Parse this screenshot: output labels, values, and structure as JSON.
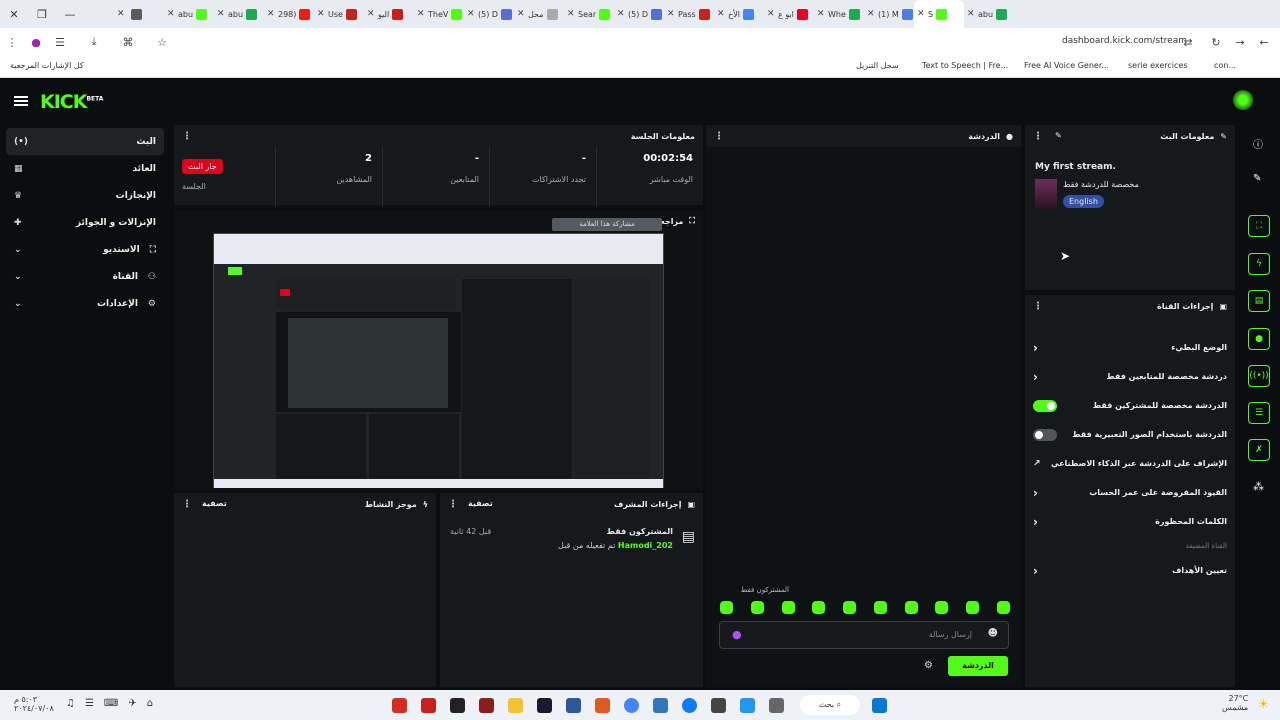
{
  "browser": {
    "tabs": [
      {
        "label": "",
        "color": "#5b5b5b"
      },
      {
        "label": "abu",
        "color": "#53fc18"
      },
      {
        "label": "abu",
        "color": "#1fa855"
      },
      {
        "label": "298)",
        "color": "#e62117"
      },
      {
        "label": "Use",
        "color": "#c5221f"
      },
      {
        "label": "اليو",
        "color": "#c5221f"
      },
      {
        "label": "TheV",
        "color": "#53fc18"
      },
      {
        "label": "(5) D",
        "color": "#5a6cd6"
      },
      {
        "label": "محل",
        "color": "#aaaaaa"
      },
      {
        "label": "Sear",
        "color": "#53fc18"
      },
      {
        "label": "(5) D",
        "color": "#5a6cd6"
      },
      {
        "label": "Pass",
        "color": "#c5221f"
      },
      {
        "label": "الأخ",
        "color": "#4285f4"
      },
      {
        "label": "ابو ع",
        "color": "#e60023"
      },
      {
        "label": "Whe",
        "color": "#1fa855"
      },
      {
        "label": "(1) M",
        "color": "#4c7de0"
      },
      {
        "label": "S",
        "color": "#53fc18",
        "active": true
      },
      {
        "label": "abu",
        "color": "#1fa855"
      }
    ],
    "url": "dashboard.kick.com/stream",
    "bookmarks": {
      "all": "كل الإشارات المرجعية",
      "history": "سجل التنزيل",
      "tts": "Text to Speech | Fre...",
      "voice": "Free AI Voice Gener...",
      "series": "serie exercices",
      "con": "con..."
    }
  },
  "app": {
    "logo": "KICK",
    "logo_beta": "BETA"
  },
  "sidebar": {
    "items": [
      {
        "label": "البث",
        "icon": "(•)"
      },
      {
        "label": "العائد",
        "icon": "▦"
      },
      {
        "label": "الإنجازات",
        "icon": "🏆"
      },
      {
        "label": "الإنزالات و الجوائز",
        "icon": "🎁"
      },
      {
        "label": "الاستديو",
        "icon": "⛶"
      },
      {
        "label": "القناة",
        "icon": "⚇"
      },
      {
        "label": "الإعدادات",
        "icon": "⚙"
      }
    ]
  },
  "session": {
    "title": "معلومات الجلسة",
    "stats": [
      {
        "value": "00:02:54",
        "label": "الوقت مباشر"
      },
      {
        "value": "-",
        "label": "تجدد الاشتراكات"
      },
      {
        "value": "-",
        "label": "المتابعين"
      },
      {
        "value": "2",
        "label": "المشاهدين"
      }
    ],
    "live_badge": "جار البث",
    "session_label": "الجلسة"
  },
  "preview": {
    "title": "مراجعة البث",
    "overlay_text": "مشاركة هذا العلامة"
  },
  "activity": {
    "title": "موجز النشاط",
    "filter": "تصفية"
  },
  "mod": {
    "title": "إجراءات المشرف",
    "filter": "تصفية",
    "entry_title": "المشتركون فقط",
    "entry_user": "Hamodi_202",
    "entry_desc": "تم تفعيله من قبل",
    "entry_time": "قبل 42 ثانية"
  },
  "chat": {
    "title": "الدردشة",
    "subs_only": "المشتركون فقط",
    "placeholder": "إرسال رسالة",
    "send": "الدردشة"
  },
  "stream_info": {
    "title": "معلومات البث",
    "stream_title": "My first stream.",
    "category": "مخصصة للدردشة فقط",
    "language": "English"
  },
  "channel_actions": {
    "title": "إجراءات القناة",
    "rows": [
      {
        "label": "الوضع البطيء",
        "type": "chevron"
      },
      {
        "label": "دردشة مخصصة للمتابعين فقط",
        "type": "chevron"
      },
      {
        "label": "الدردشة مخصصة للمشتركين فقط",
        "type": "toggle-on"
      },
      {
        "label": "الدردشة باستخدام الصور التعبيرية فقط",
        "type": "toggle-off"
      },
      {
        "label": "الإشراف على الدردشة عبر الذكاء الاصطناعي",
        "type": "ext"
      },
      {
        "label": "القيود المفروضة على عمر الحساب",
        "type": "chevron"
      },
      {
        "label": "الكلمات المحظورة",
        "type": "chevron"
      }
    ],
    "section_label": "القناة المضيفة",
    "goals": "تعيين الأهداف"
  },
  "taskbar": {
    "search": "بحث",
    "time": "٥:٠٣ م",
    "date": "٢٠٢٤/٠٧/٠٨",
    "weather": "27°C",
    "weather_desc": "مشمس"
  }
}
